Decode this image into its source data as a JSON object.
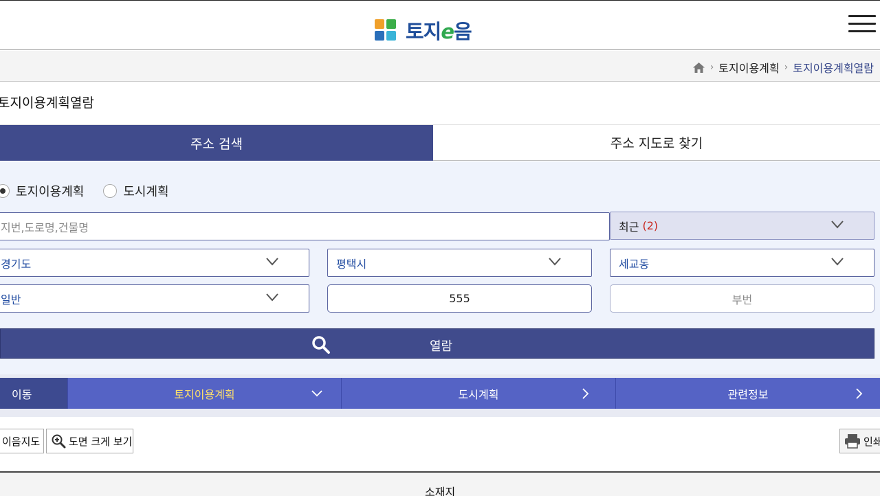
{
  "header": {
    "logo_text_1": "토지",
    "logo_text_e": "e",
    "logo_text_2": "음"
  },
  "breadcrumb": {
    "items": [
      "토지이용계획",
      "토지이용계획열람"
    ]
  },
  "page": {
    "title": "토지이용계획열람"
  },
  "tabs": [
    {
      "label": "주소 검색",
      "active": true
    },
    {
      "label": "주소 지도로 찾기",
      "active": false
    }
  ],
  "radios": [
    {
      "label": "토지이용계획",
      "checked": true
    },
    {
      "label": "도시계획",
      "checked": false
    }
  ],
  "search": {
    "address_placeholder": "지번,도로명,건물명",
    "recent_label": "최근",
    "recent_count": "(2)",
    "sido": "경기도",
    "sigungu": "평택시",
    "dong": "세교동",
    "land_type": "일반",
    "main_number": "555",
    "sub_number_placeholder": "부번",
    "submit_label": "열람"
  },
  "nav": {
    "move_label": "이동",
    "items": [
      {
        "label": "토지이용계획",
        "active": true,
        "icon": "chevron-down-icon"
      },
      {
        "label": "도시계획",
        "active": false,
        "icon": "chevron-right-icon"
      },
      {
        "label": "관련정보",
        "active": false,
        "icon": "chevron-right-icon"
      }
    ]
  },
  "tools": {
    "map_label": "이음지도",
    "zoom_label": "도면 크게 보기",
    "print_label": "인쇄"
  },
  "table": {
    "header": "소재지"
  },
  "colors": {
    "primary": "#404b8c",
    "nav": "#5563c5",
    "active_nav_text": "#ffe06a",
    "recent_count": "#c8261e",
    "select_text": "#1f4aa0",
    "search_bg": "#eff3fc"
  }
}
